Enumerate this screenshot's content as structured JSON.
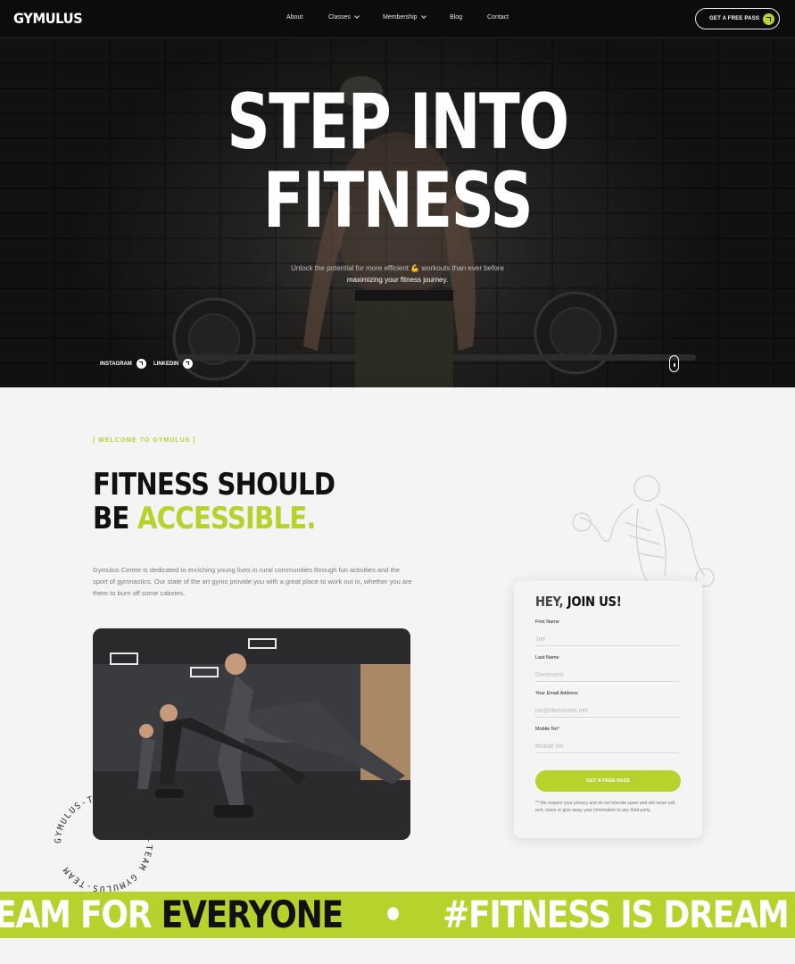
{
  "header": {
    "logo": "GYMULUS",
    "nav": [
      {
        "label": "About",
        "dropdown": false
      },
      {
        "label": "Classes",
        "dropdown": true
      },
      {
        "label": "Membership",
        "dropdown": true
      },
      {
        "label": "Blog",
        "dropdown": false
      },
      {
        "label": "Contact",
        "dropdown": false
      }
    ],
    "cta_label": "GET A FREE PASS"
  },
  "hero": {
    "title_line1": "STEP INTO",
    "title_line2": "FITNESS",
    "subtitle_line1": "Unlock the potential for more efficient 💪 workouts than ever before",
    "subtitle_line2": "maximizing your fitness journey.",
    "social": [
      {
        "label": "INSTAGRAM"
      },
      {
        "label": "LINKEDIN"
      }
    ]
  },
  "welcome": {
    "tag": "[ WELCOME TO GYMULUS ]",
    "title_line1": "FITNESS SHOULD",
    "title_line2_prefix": "BE ",
    "title_line2_accent": "ACCESSIBLE.",
    "body": "Gymulus Centre is dedicated to enriching young lives in rural communities through fun activities and the sport of gymnastics. Our state of the art gyms provide you with a great place to work out in, whether you are there to burn off some calories.",
    "badge_text": "GYMULUS-TEAM GYMULUS-TEAM GYMULUS-TEAM"
  },
  "form": {
    "title_prefix": "HEY, ",
    "title_main": "JOIN US!",
    "fields": [
      {
        "label": "First Name",
        "placeholder": "Joe"
      },
      {
        "label": "Last Name",
        "placeholder": "Dominans"
      },
      {
        "label": "Your Email Address",
        "placeholder": "joe@dominans.net"
      },
      {
        "label": "Mobile No*",
        "placeholder": "Mobile No"
      }
    ],
    "submit_label": "GET A FREE PASS",
    "note": "** We respect your privacy and do not tolerate spam and will never sell, rent, lease or give away your information to any third party."
  },
  "marquee": {
    "part1": "EAM FOR ",
    "part2": "EVERYONE",
    "part3": "#FITNESS IS DREAM"
  },
  "colors": {
    "accent": "#b6d22c",
    "dark": "#0c0c0c",
    "background": "#f4f4f4"
  }
}
